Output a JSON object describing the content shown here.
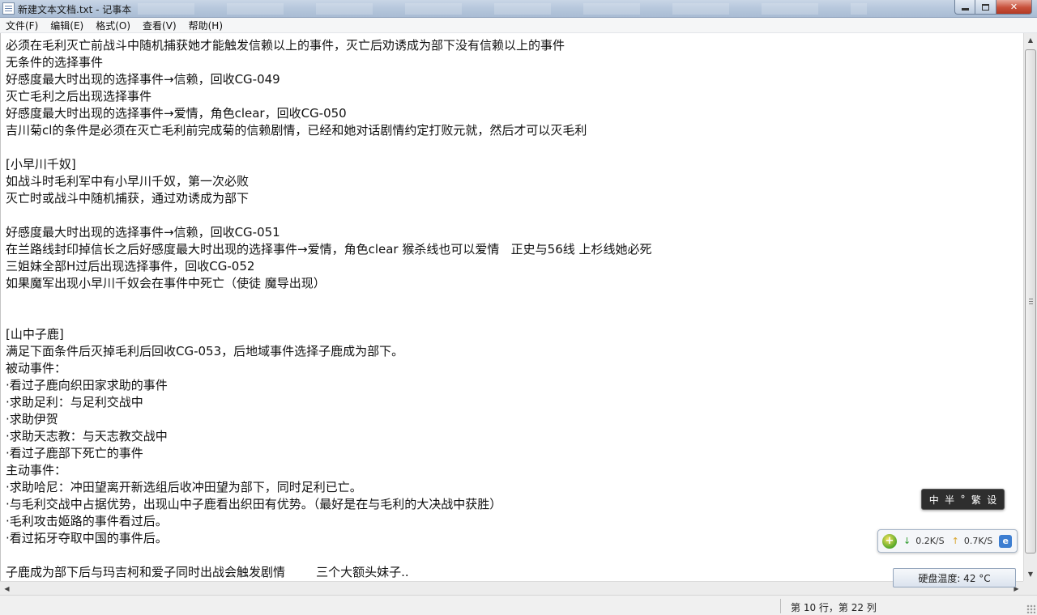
{
  "window": {
    "title": "新建文本文档.txt - 记事本",
    "controls": {
      "minimize": "",
      "maximize": "",
      "close": "✕"
    }
  },
  "menu": [
    "文件(F)",
    "编辑(E)",
    "格式(O)",
    "查看(V)",
    "帮助(H)"
  ],
  "editor": {
    "lines": [
      "必须在毛利灭亡前战斗中随机捕获她才能触发信赖以上的事件，灭亡后劝诱成为部下没有信赖以上的事件",
      "无条件的选择事件",
      "好感度最大时出现的选择事件→信赖，回收CG-049",
      "灭亡毛利之后出现选择事件",
      "好感度最大时出现的选择事件→爱情，角色clear，回收CG-050",
      "吉川菊cl的条件是必须在灭亡毛利前完成菊的信赖剧情，已经和她对话剧情约定打败元就，然后才可以灭毛利",
      "",
      "[小早川千奴]",
      "如战斗时毛利军中有小早川千奴，第一次必败",
      "灭亡时或战斗中随机捕获，通过劝诱成为部下",
      "",
      "好感度最大时出现的选择事件→信赖，回收CG-051",
      "在兰路线封印掉信长之后好感度最大时出现的选择事件→爱情，角色clear 猴杀线也可以爱情   正史与56线 上杉线她必死",
      "三姐妹全部H过后出现选择事件，回收CG-052",
      "如果魔军出现小早川千奴会在事件中死亡（使徒 魔导出现）",
      "",
      "",
      "[山中子鹿]",
      "满足下面条件后灭掉毛利后回收CG-053，后地域事件选择子鹿成为部下。",
      "被动事件：",
      "·看过子鹿向织田家求助的事件",
      "·求助足利：与足利交战中",
      "·求助伊贺",
      "·求助天志教：与天志教交战中",
      "·看过子鹿部下死亡的事件",
      "主动事件：",
      "·求助哈尼：冲田望离开新选组后收冲田望为部下，同时足利已亡。",
      "·与毛利交战中占据优势，出现山中子鹿看出织田有优势。（最好是在与毛利的大决战中获胜）",
      "·毛利攻击姬路的事件看过后。",
      "·看过拓牙夺取中国的事件后。",
      "",
      "子鹿成为部下后与玛吉柯和爱子同时出战会触发剧情        三个大额头妹子.."
    ]
  },
  "statusbar": {
    "position": "第 10 行，第 22 列"
  },
  "overlays": {
    "ime": [
      "中",
      "半",
      "°",
      "繁",
      "设"
    ],
    "network": {
      "logo": "+",
      "download_arrow": "↓",
      "download": "0.2K/S",
      "upload_arrow": "↑",
      "upload": "0.7K/S",
      "ie_icon": "e"
    },
    "temperature": "硬盘温度: 42 °C"
  },
  "colors": {
    "titlebar": "#b6c7dc",
    "close_button": "#c7503a",
    "editor_bg": "#ffffff",
    "ime_bg": "#2e2e2e"
  }
}
